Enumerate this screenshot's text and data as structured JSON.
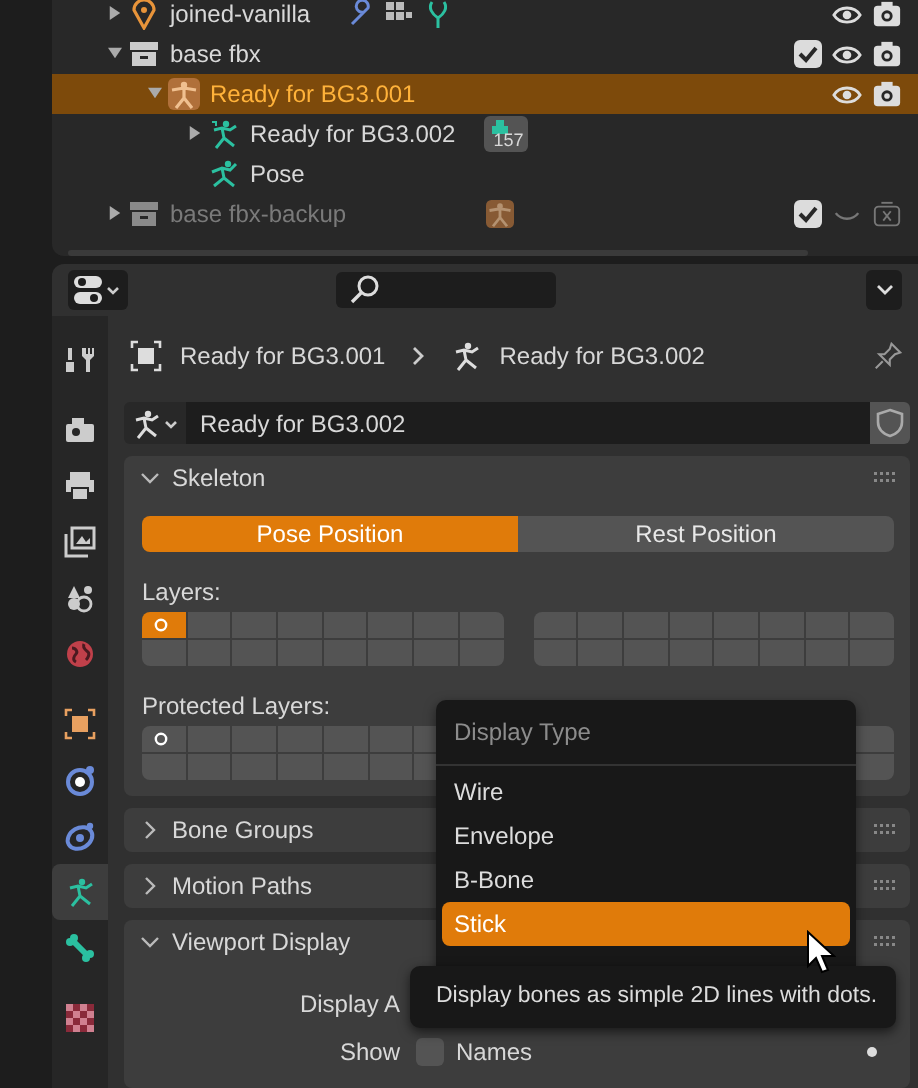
{
  "outliner": {
    "rows": [
      {
        "kind": "object",
        "label": "joined-vanilla",
        "expanded": false,
        "selected": false,
        "disabled": false,
        "extras": true,
        "visible": true,
        "renderable": true
      },
      {
        "kind": "collection",
        "label": "base fbx",
        "expanded": true,
        "selected": false,
        "disabled": false,
        "extras": false,
        "checked": true,
        "visible": true,
        "renderable": true,
        "children": [
          {
            "kind": "armature",
            "label": "Ready for BG3.001",
            "expanded": true,
            "selected": true,
            "disabled": false,
            "extras": false,
            "visible": true,
            "renderable": true,
            "children": [
              {
                "kind": "armature-data",
                "label": "Ready for BG3.002",
                "expanded": false,
                "selected": false,
                "disabled": false,
                "extras": false,
                "badge": "157"
              },
              {
                "kind": "pose",
                "label": "Pose",
                "selected": false,
                "disabled": false,
                "extras": false
              }
            ]
          }
        ]
      },
      {
        "kind": "collection",
        "label": "base fbx-backup",
        "expanded": false,
        "selected": false,
        "disabled": true,
        "extras": false,
        "checked": true,
        "visible": false,
        "renderable": false,
        "trailing": {
          "kind": "armature"
        }
      }
    ]
  },
  "properties": {
    "tab_groups": [
      [
        {
          "kind": "tool",
          "selected": false
        }
      ],
      [
        {
          "kind": "render",
          "selected": false
        },
        {
          "kind": "output",
          "selected": false
        },
        {
          "kind": "view-layer",
          "selected": false
        },
        {
          "kind": "scene",
          "selected": false
        },
        {
          "kind": "world",
          "selected": false
        }
      ],
      [
        {
          "kind": "object",
          "selected": false
        },
        {
          "kind": "physics",
          "selected": false
        },
        {
          "kind": "constraints",
          "selected": false
        },
        {
          "kind": "armature",
          "selected": true
        },
        {
          "kind": "bone",
          "selected": false
        }
      ],
      [
        {
          "kind": "texture",
          "selected": false
        }
      ]
    ],
    "breadcrumb": [
      {
        "kind": "object",
        "label": "Ready for BG3.001"
      },
      {
        "kind": "armature-data",
        "label": "Ready for BG3.002"
      }
    ],
    "datablock": {
      "name": "Ready for BG3.002"
    },
    "panels": [
      {
        "kind": "skeleton",
        "title": "Skeleton",
        "expanded": true,
        "positions": [
          {
            "label": "Pose Position",
            "selected": true
          },
          {
            "label": "Rest Position",
            "selected": false
          }
        ],
        "layers_label": "Layers:",
        "layers": [
          {
            "cells": [
              {
                "selected": true,
                "used": true
              },
              {
                "selected": false,
                "used": false
              },
              {
                "selected": false,
                "used": false
              },
              {
                "selected": false,
                "used": false
              },
              {
                "selected": false,
                "used": false
              },
              {
                "selected": false,
                "used": false
              },
              {
                "selected": false,
                "used": false
              },
              {
                "selected": false,
                "used": false
              },
              {
                "selected": false,
                "used": false
              },
              {
                "selected": false,
                "used": false
              },
              {
                "selected": false,
                "used": false
              },
              {
                "selected": false,
                "used": false
              },
              {
                "selected": false,
                "used": false
              },
              {
                "selected": false,
                "used": false
              },
              {
                "selected": false,
                "used": false
              },
              {
                "selected": false,
                "used": false
              }
            ]
          },
          {
            "cells": [
              {
                "selected": false,
                "used": false
              },
              {
                "selected": false,
                "used": false
              },
              {
                "selected": false,
                "used": false
              },
              {
                "selected": false,
                "used": false
              },
              {
                "selected": false,
                "used": false
              },
              {
                "selected": false,
                "used": false
              },
              {
                "selected": false,
                "used": false
              },
              {
                "selected": false,
                "used": false
              },
              {
                "selected": false,
                "used": false
              },
              {
                "selected": false,
                "used": false
              },
              {
                "selected": false,
                "used": false
              },
              {
                "selected": false,
                "used": false
              },
              {
                "selected": false,
                "used": false
              },
              {
                "selected": false,
                "used": false
              },
              {
                "selected": false,
                "used": false
              },
              {
                "selected": false,
                "used": false
              }
            ]
          }
        ],
        "protected_label": "Protected Layers:",
        "protected": [
          {
            "cells": [
              {
                "selected": false,
                "used": true
              },
              {
                "selected": false,
                "used": false
              },
              {
                "selected": false,
                "used": false
              },
              {
                "selected": false,
                "used": false
              },
              {
                "selected": false,
                "used": false
              },
              {
                "selected": false,
                "used": false
              },
              {
                "selected": false,
                "used": false
              },
              {
                "selected": false,
                "used": false
              },
              {
                "selected": false,
                "used": false
              },
              {
                "selected": false,
                "used": false
              },
              {
                "selected": false,
                "used": false
              },
              {
                "selected": false,
                "used": false
              },
              {
                "selected": false,
                "used": false
              },
              {
                "selected": false,
                "used": false
              }
            ]
          },
          {
            "cells": [
              {
                "selected": false,
                "used": false
              },
              {
                "selected": false,
                "used": false
              }
            ]
          }
        ]
      },
      {
        "title": "Bone Groups",
        "expanded": false
      },
      {
        "title": "Motion Paths",
        "expanded": false
      },
      {
        "kind": "display",
        "title": "Viewport Display",
        "expanded": true,
        "display_label": "Display A",
        "show_label": "Show",
        "names": {
          "label": "Names",
          "checked": false
        }
      }
    ]
  },
  "menu": {
    "title": "Display Type",
    "items": [
      {
        "label": "Wire",
        "selected": false
      },
      {
        "label": "Envelope",
        "selected": false
      },
      {
        "label": "B-Bone",
        "selected": false
      },
      {
        "label": "Stick",
        "selected": true
      }
    ]
  },
  "tooltip": {
    "text": "Display bones as simple 2D lines with dots."
  }
}
